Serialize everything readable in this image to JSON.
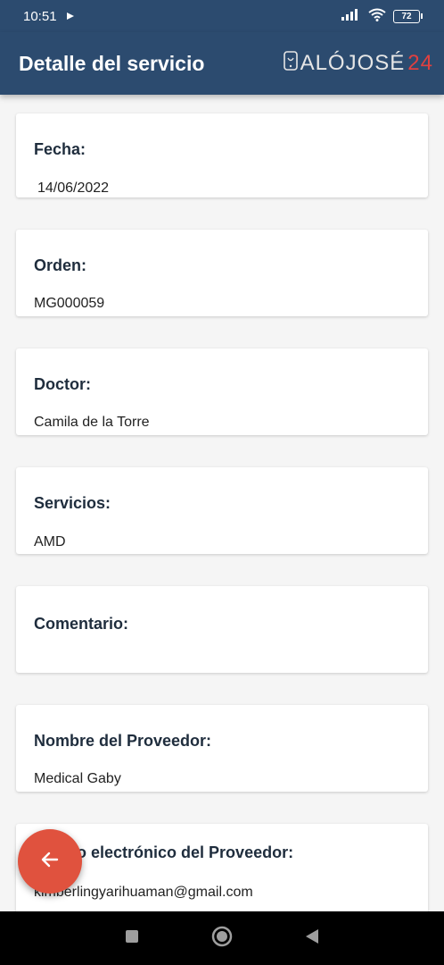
{
  "status_bar": {
    "time": "10:51",
    "battery": "72"
  },
  "app_bar": {
    "title": "Detalle del servicio",
    "logo_text_main": "ALÓJOSÉ",
    "logo_text_accent": "24"
  },
  "fields": [
    {
      "label": "Fecha:",
      "value": "14/06/2022"
    },
    {
      "label": "Orden:",
      "value": "MG000059"
    },
    {
      "label": "Doctor:",
      "value": "Camila de la Torre"
    },
    {
      "label": "Servicios:",
      "value": "AMD"
    },
    {
      "label": "Comentario:",
      "value": ""
    },
    {
      "label": "Nombre del Proveedor:",
      "value": "Medical Gaby"
    },
    {
      "label": "Correo electrónico del Proveedor:",
      "value": "kimberlingyarihuaman@gmail.com"
    }
  ],
  "colors": {
    "primary": "#2c4b6f",
    "fab": "#e0523e",
    "background": "#f5f5f5"
  },
  "icons": {
    "back": "arrow-left-icon",
    "logo": "phone-logo-icon"
  }
}
